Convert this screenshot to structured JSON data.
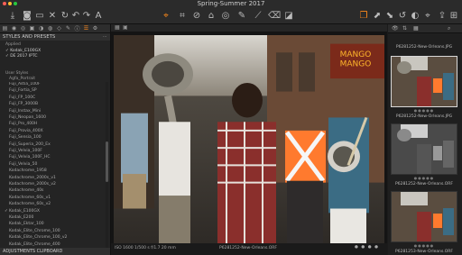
{
  "window": {
    "title": "Spring-Summer 2017",
    "controls": {
      "close_color": "#ff5f57",
      "min_color": "#ffbd2e",
      "max_color": "#28c940"
    }
  },
  "toolbar": {
    "icons": [
      "import-icon",
      "camera-icon",
      "folder-icon",
      "delete-icon",
      "rotate-icon",
      "undo-icon",
      "redo-icon",
      "text-icon",
      "select-icon",
      "crop-icon",
      "straighten-icon",
      "keystone-icon",
      "spot-icon",
      "picker-icon",
      "brush-icon",
      "eraser-icon",
      "gradient-icon",
      "stack-icon",
      "copy-icon",
      "apply-icon",
      "reset-icon",
      "compare-icon",
      "grid-icon",
      "export-icon"
    ],
    "accent": "#ff8a1a"
  },
  "sidebar": {
    "styles_header": "STYLES AND PRESETS",
    "applied_label": "Applied",
    "applied_items": [
      "Kodak_E100GX",
      "DE 2017 IPTC"
    ],
    "user_styles_label": "User Styles",
    "user_styles_first": "Agfa_Portrait",
    "styles": [
      {
        "label": "Fuji_Astia_100F",
        "checked": false
      },
      {
        "label": "Fuji_Fortia_SP",
        "checked": false
      },
      {
        "label": "Fuji_FP_100C",
        "checked": false
      },
      {
        "label": "Fuji_FP_3000B",
        "checked": false
      },
      {
        "label": "Fuji_Instax_Mini",
        "checked": false
      },
      {
        "label": "Fuji_Neopan_1600",
        "checked": false
      },
      {
        "label": "Fuji_Pro_400H",
        "checked": false
      },
      {
        "label": "Fuji_Provia_400X",
        "checked": false
      },
      {
        "label": "Fuji_Sensia_100",
        "checked": false
      },
      {
        "label": "Fuji_Superia_200_Ex",
        "checked": false
      },
      {
        "label": "Fuji_Velvia_100F",
        "checked": false
      },
      {
        "label": "Fuji_Velvia_100F_HC",
        "checked": false
      },
      {
        "label": "Fuji_Velvia_50",
        "checked": false
      },
      {
        "label": "Kodachrome_1958",
        "checked": false
      },
      {
        "label": "Kodachrome_2000s_v1",
        "checked": false
      },
      {
        "label": "Kodachrome_2000s_v2",
        "checked": false
      },
      {
        "label": "Kodachrome_40s",
        "checked": false
      },
      {
        "label": "Kodachrome_60s_v1",
        "checked": false
      },
      {
        "label": "Kodachrome_60s_v2",
        "checked": false
      },
      {
        "label": "Kodak_E100GX",
        "checked": true
      },
      {
        "label": "Kodak_E200",
        "checked": false
      },
      {
        "label": "Kodak_Ektar_100",
        "checked": false
      },
      {
        "label": "Kodak_Elite_Chrome_100",
        "checked": false
      },
      {
        "label": "Kodak_Elite_Chrome_100_v2",
        "checked": false
      },
      {
        "label": "Kodak_Elite_Chrome_400",
        "checked": false
      }
    ],
    "bottom_header": "ADJUSTMENTS CLIPBOARD"
  },
  "viewer": {
    "exif": "ISO 1600   1/500 s   f/1.7   20 mm",
    "filename": "P6281252-New-Orleans.ORF",
    "zoom_label": "Fit"
  },
  "browser": {
    "thumbs": [
      {
        "caption": "P6281252-New-Orleans.JPG",
        "selected": true,
        "bw": false
      },
      {
        "caption": "P6281252-New-Orleans.ORF",
        "selected": false,
        "bw": true
      },
      {
        "caption": "P6281253-New-Orleans.ORF",
        "selected": false,
        "bw": false
      }
    ],
    "top_caption": "P6281252-New-Orleans.JPG"
  }
}
